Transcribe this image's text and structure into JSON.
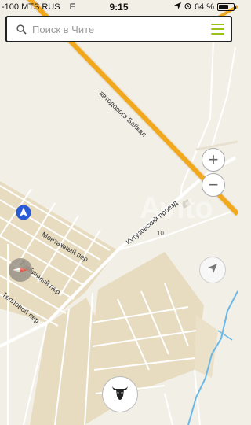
{
  "status": {
    "carrier": "-100 MTS RUS",
    "network": "E",
    "time": "9:15",
    "battery_text": "64 %",
    "battery_level": 0.64
  },
  "search": {
    "placeholder": "Поиск в Чите"
  },
  "map": {
    "road_labels": {
      "baikal": "автодорога Байкал",
      "kutuzov": "Кутузовский проезд",
      "montazh": "Монтажный пер",
      "turbin": "Турбинный пер",
      "teplov": "Тепловой пер"
    },
    "house_number": "10",
    "watermark": "Avito",
    "colors": {
      "background": "#f2efe6",
      "block": "#e8dcc0",
      "highway": "#f2a81d",
      "road": "#ffffff",
      "river": "#69b8e8",
      "accent": "#9cc21a"
    }
  },
  "controls": {
    "zoom_in": "+",
    "zoom_out": "−"
  }
}
